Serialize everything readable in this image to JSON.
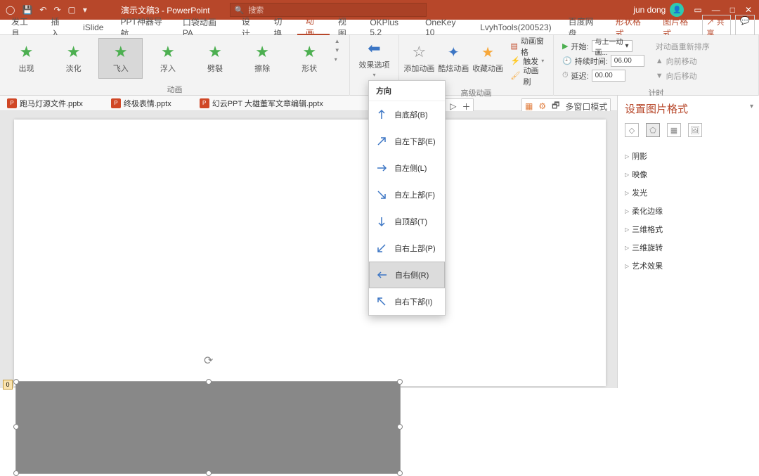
{
  "titlebar": {
    "title": "演示文稿3 - PowerPoint",
    "search_ph": "搜索",
    "user": "jun dong"
  },
  "tabs": {
    "items": [
      "发工具",
      "插入",
      "iSlide",
      "PPT神器导航",
      "口袋动画 PA",
      "设计",
      "切换",
      "动画",
      "视图",
      "OKPlus 5.2",
      "OneKey 10",
      "LvyhTools(200523)",
      "百度网盘",
      "形状格式",
      "图片格式"
    ],
    "share": "共享"
  },
  "ribbon": {
    "anim_group": "动画",
    "anims": [
      "出现",
      "淡化",
      "飞入",
      "浮入",
      "劈裂",
      "擦除",
      "形状"
    ],
    "effect_opts": "效果选项",
    "adv_group": "高级动画",
    "adv": {
      "add": "添加动画",
      "cool": "酷炫动画",
      "fav": "收藏动画",
      "pane": "动画窗格",
      "trigger": "触发",
      "painter": "动画刷"
    },
    "timing_group": "计时",
    "timing": {
      "start": "开始:",
      "start_val": "与上一动画...",
      "dur": "持续时间:",
      "dur_val": "06.00",
      "delay": "延迟:",
      "delay_val": "00.00",
      "reorder": "对动画重新排序",
      "fwd": "向前移动",
      "back": "向后移动"
    }
  },
  "docs": [
    "跑马灯源文件.pptx",
    "终极表情.pptx",
    "幻云PPT 大雄董军文章编辑.pptx"
  ],
  "minitb": "多窗口模式",
  "effect_menu": {
    "header": "方向",
    "opts": [
      "自底部(B)",
      "自左下部(E)",
      "自左侧(L)",
      "自左上部(F)",
      "自顶部(T)",
      "自右上部(P)",
      "自右侧(R)",
      "自右下部(I)"
    ],
    "selected": 6
  },
  "tag": "0",
  "format_pane": {
    "title": "设置图片格式",
    "sections": [
      "阴影",
      "映像",
      "发光",
      "柔化边缘",
      "三维格式",
      "三维旋转",
      "艺术效果"
    ]
  }
}
